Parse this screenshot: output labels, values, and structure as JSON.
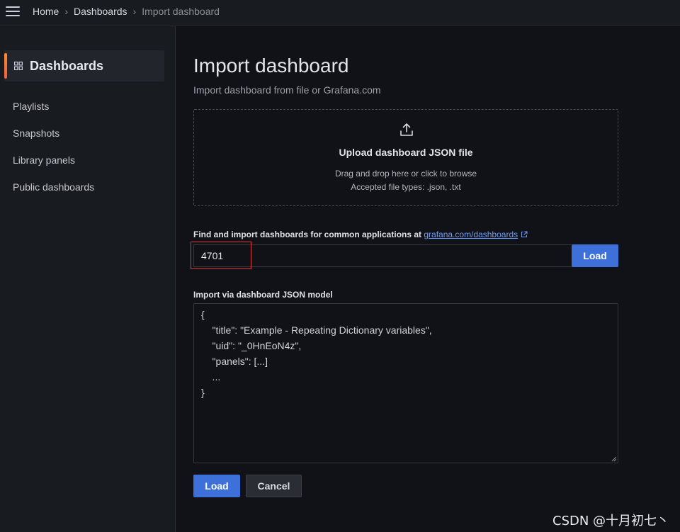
{
  "breadcrumb": {
    "items": [
      "Home",
      "Dashboards",
      "Import dashboard"
    ]
  },
  "sidebar": {
    "title": "Dashboards",
    "items": [
      {
        "label": "Playlists"
      },
      {
        "label": "Snapshots"
      },
      {
        "label": "Library panels"
      },
      {
        "label": "Public dashboards"
      }
    ]
  },
  "main": {
    "title": "Import dashboard",
    "subtitle": "Import dashboard from file or Grafana.com",
    "upload": {
      "title": "Upload dashboard JSON file",
      "hint": "Drag and drop here or click to browse",
      "accepted": "Accepted file types: .json, .txt"
    },
    "grafana_com": {
      "label": "Find and import dashboards for common applications at",
      "link": "grafana.com/dashboards",
      "value": "4701",
      "load_label": "Load"
    },
    "json_model": {
      "label": "Import via dashboard JSON model",
      "placeholder": "{\n    \"title\": \"Example - Repeating Dictionary variables\",\n    \"uid\": \"_0HnEoN4z\",\n    \"panels\": [...]\n    ...\n}"
    },
    "buttons": {
      "load": "Load",
      "cancel": "Cancel"
    }
  },
  "watermark": "CSDN @十月初七丶",
  "colors": {
    "accent": "#3d71d9",
    "highlight": "#e0393e",
    "link": "#6e9fff",
    "active_indicator": "#ff8833"
  }
}
